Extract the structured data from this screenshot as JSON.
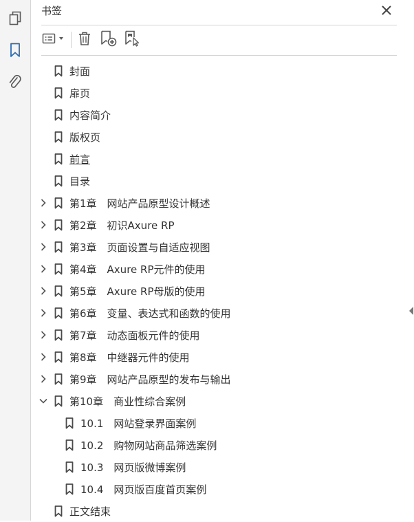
{
  "panel": {
    "title": "书签"
  },
  "toolbar": {
    "options_icon": "list-options-icon",
    "delete_icon": "trash-icon",
    "new_bookmark_icon": "new-bookmark-icon",
    "find_bookmark_icon": "find-bookmark-icon"
  },
  "rail": [
    "pages-icon",
    "bookmark-icon",
    "attachment-icon"
  ],
  "bookmarks": [
    {
      "label": "封面",
      "level": 0,
      "toggle": "none"
    },
    {
      "label": "扉页",
      "level": 0,
      "toggle": "none"
    },
    {
      "label": "内容简介",
      "level": 0,
      "toggle": "none"
    },
    {
      "label": "版权页",
      "level": 0,
      "toggle": "none"
    },
    {
      "label": "前言",
      "level": 0,
      "toggle": "none",
      "underline": true
    },
    {
      "label": "目录",
      "level": 0,
      "toggle": "none"
    },
    {
      "label": "第1章　网站产品原型设计概述",
      "level": 0,
      "toggle": "collapsed"
    },
    {
      "label": "第2章　初识Axure RP",
      "level": 0,
      "toggle": "collapsed"
    },
    {
      "label": "第3章　页面设置与自适应视图",
      "level": 0,
      "toggle": "collapsed"
    },
    {
      "label": "第4章　Axure RP元件的使用",
      "level": 0,
      "toggle": "collapsed"
    },
    {
      "label": "第5章　Axure RP母版的使用",
      "level": 0,
      "toggle": "collapsed"
    },
    {
      "label": "第6章　变量、表达式和函数的使用",
      "level": 0,
      "toggle": "collapsed"
    },
    {
      "label": "第7章　动态面板元件的使用",
      "level": 0,
      "toggle": "collapsed"
    },
    {
      "label": "第8章　中继器元件的使用",
      "level": 0,
      "toggle": "collapsed"
    },
    {
      "label": "第9章　网站产品原型的发布与输出",
      "level": 0,
      "toggle": "collapsed"
    },
    {
      "label": "第10章　商业性综合案例",
      "level": 0,
      "toggle": "expanded"
    },
    {
      "label": "10.1　网站登录界面案例",
      "level": 1,
      "toggle": "none"
    },
    {
      "label": "10.2　购物网站商品筛选案例",
      "level": 1,
      "toggle": "none"
    },
    {
      "label": "10.3　网页版微博案例",
      "level": 1,
      "toggle": "none"
    },
    {
      "label": "10.4　网页版百度首页案例",
      "level": 1,
      "toggle": "none"
    },
    {
      "label": "正文结束",
      "level": 0,
      "toggle": "none"
    }
  ],
  "colors": {
    "accent": "#2b6cb8",
    "icon": "#5a5a5a"
  }
}
